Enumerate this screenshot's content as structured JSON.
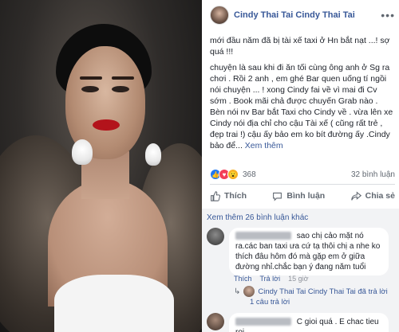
{
  "post": {
    "author": "Cindy Thai Tai Cindy Thai Tai",
    "paragraphs": [
      "mới đầu năm đã bị tài xế taxi ở Hn bắt nạt ...! sợ quá !!!",
      "chuyện là sau khi đi ăn tối cùng ông anh ở Sg ra chơi . Rồi 2 anh , em ghé Bar quen uống tí ngồi nói chuyện ... ! xong Cindy fai về vì mai đi Cv sớm . Book mãi chả được chuyến Grab nào . Bèn nói nv Bar bắt Taxi cho Cindy về . vừa lên xe Cindy nói địa chỉ cho cậu Tài xế ( cũng rất trẻ , đẹp trai !) cậu ấy bảo em ko bít đường ấy .Cindy bảo để..."
    ],
    "see_more": "Xem thêm",
    "reaction_count": "368",
    "comment_count": "32 bình luận",
    "actions": {
      "like": "Thích",
      "comment": "Bình luận",
      "share": "Chia sẻ"
    }
  },
  "comments": {
    "view_more": "Xem thêm 26 bình luận khác",
    "first": {
      "text": "sao chị cảo mặt nó ra.các ban taxi ưa cứ tạ thôi chị a nhe ko thích đâu hôm đó mà gặp em ở giữa đường nhỉ.chắc bạn ý đang năm tuổi",
      "like": "Thích",
      "reply": "Trả lời",
      "time": "15 giờ",
      "reply_by": "Cindy Thai Tai Cindy Thai Tai đã trả lời",
      "reply_count": "1 câu trả lời"
    },
    "second": {
      "text": "C gioi quá . E chac tieu roi"
    }
  },
  "colors": {
    "link": "#385898",
    "bg_comments": "#f2f3f5",
    "like": "#2078f4",
    "love": "#f33e58",
    "wow": "#f7b125"
  }
}
